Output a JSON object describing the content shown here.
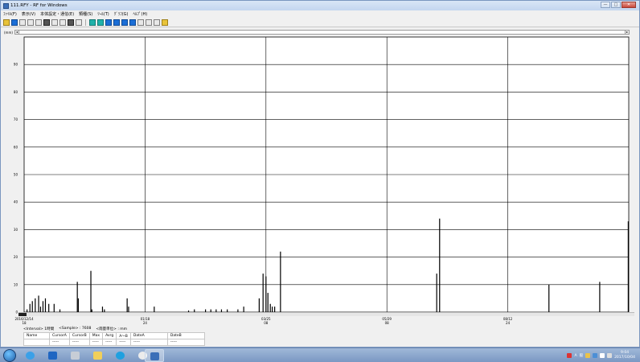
{
  "window": {
    "title": "111.RFY - RF for Windows"
  },
  "menu": [
    "ﾌｧｲﾙ(F)",
    "表示(V)",
    "本体設定・通信(E)",
    "類種(S)",
    "ﾂｰﾙ(T)",
    "ｸﾞﾗﾌ(G)",
    "ﾍﾙﾌﾟ(H)"
  ],
  "window_controls": {
    "minimize": "—",
    "maximize": "□",
    "close": "✕"
  },
  "toolbar": [
    "open-icon",
    "save-icon",
    "print-icon",
    "table-icon",
    "cursor-icon",
    "copy-icon",
    "paste-icon",
    "fit-icon",
    "printer-icon",
    "preview-icon",
    "blue-icon-1",
    "teal-icon",
    "blue-icon-2",
    "blue-icon-3",
    "blue-icon-4",
    "blue-icon-5",
    "grid-icon",
    "zoom-in-icon",
    "zoom-out-icon",
    "help-icon"
  ],
  "chart_data": {
    "type": "bar",
    "y_unit": "(mm)",
    "ylim": [
      0,
      100
    ],
    "yticks": [
      0,
      10,
      20,
      30,
      40,
      50,
      60,
      70,
      80,
      90
    ],
    "xlim": [
      0,
      125
    ],
    "grid": true,
    "x_ticks": [
      {
        "x": 0,
        "date": "2016/12/14",
        "time": "18"
      },
      {
        "x": 25,
        "date": "01/18",
        "time": "24"
      },
      {
        "x": 50,
        "date": "03/25",
        "time": "08"
      },
      {
        "x": 75,
        "date": "05/29",
        "time": "08"
      },
      {
        "x": 100,
        "date": "08/12",
        "time": "24"
      }
    ],
    "bars": [
      [
        0.6,
        1
      ],
      [
        1.2,
        3
      ],
      [
        1.7,
        4
      ],
      [
        2.3,
        5
      ],
      [
        3.0,
        6
      ],
      [
        3.4,
        2
      ],
      [
        3.9,
        4
      ],
      [
        4.4,
        5
      ],
      [
        5.1,
        3
      ],
      [
        6.2,
        3
      ],
      [
        7.4,
        1
      ],
      [
        11.0,
        11
      ],
      [
        11.2,
        5
      ],
      [
        13.8,
        15
      ],
      [
        14.0,
        1
      ],
      [
        16.2,
        2
      ],
      [
        16.6,
        1
      ],
      [
        21.3,
        5
      ],
      [
        21.6,
        2
      ],
      [
        26.9,
        2
      ],
      [
        34.0,
        0.6
      ],
      [
        35.2,
        1
      ],
      [
        37.5,
        1
      ],
      [
        38.6,
        1
      ],
      [
        39.7,
        1
      ],
      [
        40.8,
        1
      ],
      [
        42.0,
        1
      ],
      [
        44.2,
        1
      ],
      [
        45.4,
        2
      ],
      [
        48.6,
        5
      ],
      [
        49.4,
        14
      ],
      [
        50.0,
        13
      ],
      [
        50.4,
        7
      ],
      [
        50.9,
        3
      ],
      [
        51.3,
        2
      ],
      [
        51.8,
        2
      ],
      [
        53.0,
        22
      ],
      [
        85.3,
        14
      ],
      [
        85.9,
        34
      ],
      [
        108.5,
        10
      ],
      [
        119.0,
        11
      ],
      [
        124.9,
        33
      ]
    ]
  },
  "info": {
    "interval_label": "<Interval>",
    "interval_value": "1時間",
    "sample_label": "<Sample>",
    "sample_value": "7608",
    "unit_label": "<雨量単位>",
    "unit_value": "mm"
  },
  "stats_table": {
    "headers": [
      "Name",
      "CursorA",
      "CursorB",
      "Max",
      "Avrg",
      "A～B",
      "DateA",
      "DateB"
    ],
    "row": [
      "",
      "-----",
      "-----",
      "-----",
      "-----",
      "-----",
      "-----",
      "-----"
    ]
  },
  "taskbar": {
    "apps": [
      "ie-icon",
      "outlook-icon",
      "tools-icon",
      "folder-icon",
      "skype-icon",
      "sync-icon",
      "rf-app-icon"
    ],
    "tray": {
      "ime_a": "A",
      "ime_mode": "般",
      "time": "9:04",
      "date": "2017/10/04"
    }
  }
}
